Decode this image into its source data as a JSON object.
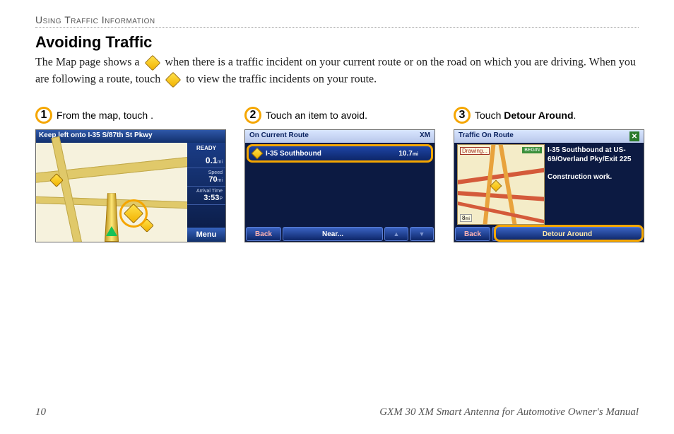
{
  "section_header": "Using Traffic Information",
  "heading": "Avoiding Traffic",
  "intro": {
    "part1": "The Map page shows a",
    "part2": "when there is a traffic incident on your current route or on the road on which you are driving. When you are following a route, touch",
    "part3": "to view the traffic incidents on your route."
  },
  "steps": [
    {
      "num": "1",
      "caption_pre": "From the map, touch",
      "caption_post": "."
    },
    {
      "num": "2",
      "caption": "Touch an item to avoid."
    },
    {
      "num": "3",
      "caption_pre": "Touch ",
      "caption_bold": "Detour Around",
      "caption_post": "."
    }
  ],
  "screen1": {
    "topbar": "Keep left onto I-35 S/87th St Pkwy",
    "ready": "READY",
    "dist": "0.1",
    "dist_unit": "mi",
    "speed_label": "Speed",
    "speed": "70",
    "speed_unit": "mi",
    "arrival_label": "Arrival Time",
    "arrival": "3:53",
    "arrival_ampm": "P",
    "menu": "Menu"
  },
  "screen2": {
    "title_left": "On Current Route",
    "title_right": "XM",
    "row_name": "I-35 Southbound",
    "row_dist": "10.7",
    "row_unit": "mi",
    "back": "Back",
    "near": "Near..."
  },
  "screen3": {
    "title_left": "Traffic On Route",
    "drawing": "Drawing...",
    "begin": "BEGIN",
    "loc": "I-35 Southbound at US-69/Overland Pky/Exit 225",
    "desc": "Construction work.",
    "scale": "8",
    "scale_unit": "mi",
    "back": "Back",
    "detour": "Detour Around"
  },
  "footer": {
    "page": "10",
    "manual": "GXM 30 XM Smart Antenna for Automotive Owner's Manual"
  }
}
